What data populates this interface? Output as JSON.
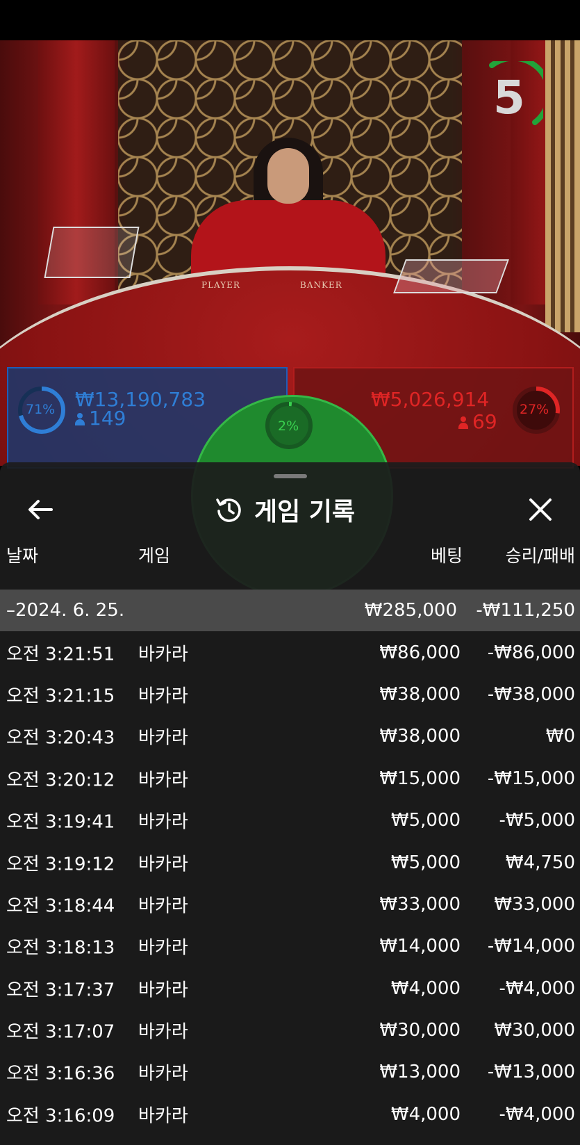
{
  "live": {
    "timer": "5",
    "felt_player": "PLAYER",
    "felt_banker": "BANKER",
    "player": {
      "percent": "71%",
      "amount": "₩13,190,783",
      "count": "149"
    },
    "tie": {
      "percent": "2%"
    },
    "banker": {
      "percent": "27%",
      "amount": "₩5,026,914",
      "count": "69"
    }
  },
  "history": {
    "title": "게임 기록",
    "columns": {
      "date": "날짜",
      "game": "게임",
      "bet": "베팅",
      "result": "승리/패배"
    },
    "day": {
      "date": "–2024. 6. 25.",
      "bet": "₩285,000",
      "result": "-₩111,250"
    },
    "rows": [
      {
        "time": "오전 3:21:51",
        "game": "바카라",
        "bet": "₩86,000",
        "result": "-₩86,000"
      },
      {
        "time": "오전 3:21:15",
        "game": "바카라",
        "bet": "₩38,000",
        "result": "-₩38,000"
      },
      {
        "time": "오전 3:20:43",
        "game": "바카라",
        "bet": "₩38,000",
        "result": "₩0"
      },
      {
        "time": "오전 3:20:12",
        "game": "바카라",
        "bet": "₩15,000",
        "result": "-₩15,000"
      },
      {
        "time": "오전 3:19:41",
        "game": "바카라",
        "bet": "₩5,000",
        "result": "-₩5,000"
      },
      {
        "time": "오전 3:19:12",
        "game": "바카라",
        "bet": "₩5,000",
        "result": "₩4,750"
      },
      {
        "time": "오전 3:18:44",
        "game": "바카라",
        "bet": "₩33,000",
        "result": "₩33,000"
      },
      {
        "time": "오전 3:18:13",
        "game": "바카라",
        "bet": "₩14,000",
        "result": "-₩14,000"
      },
      {
        "time": "오전 3:17:37",
        "game": "바카라",
        "bet": "₩4,000",
        "result": "-₩4,000"
      },
      {
        "time": "오전 3:17:07",
        "game": "바카라",
        "bet": "₩30,000",
        "result": "₩30,000"
      },
      {
        "time": "오전 3:16:36",
        "game": "바카라",
        "bet": "₩13,000",
        "result": "-₩13,000"
      },
      {
        "time": "오전 3:16:09",
        "game": "바카라",
        "bet": "₩4,000",
        "result": "-₩4,000"
      }
    ]
  }
}
